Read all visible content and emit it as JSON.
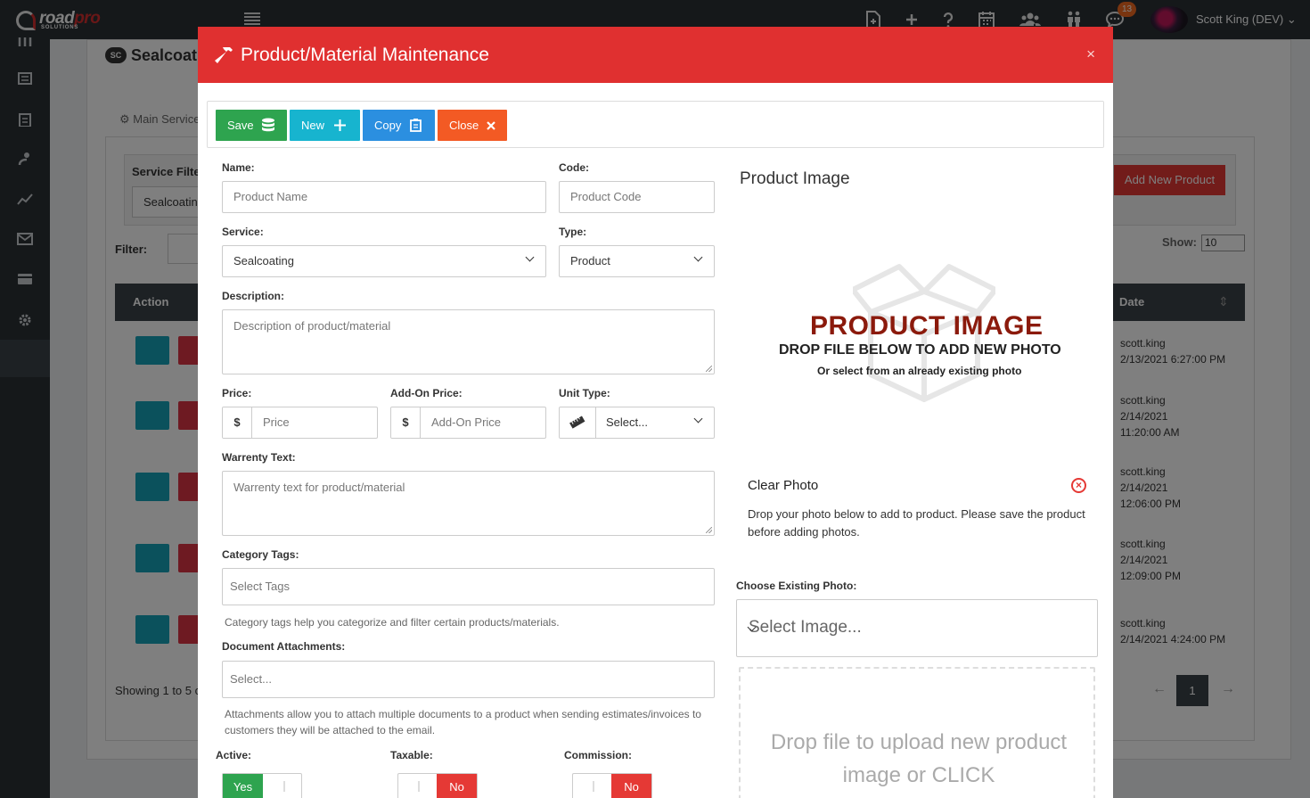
{
  "app": {
    "logo_text_1": "road",
    "logo_text_2": "pro",
    "logo_sub": "SOLUTIONS",
    "notification_count": "13",
    "user_name": "Scott King (DEV)"
  },
  "background": {
    "page_title": "Sealcoati",
    "page_badge": "SC",
    "tab_main_service": "Main Service",
    "service_filter_label": "Service Filte",
    "service_filter_value": "Sealcoatin",
    "filter_label": "Filter:",
    "add_new_product": "Add New Product",
    "show_label": "Show:",
    "show_value": "10",
    "col_action": "Action",
    "col_date": "Date",
    "rows": [
      {
        "user": "scott.king",
        "date": "2/13/2021 6:27:00 PM"
      },
      {
        "user": "scott.king",
        "date": "2/14/2021 11:20:00 AM"
      },
      {
        "user": "scott.king",
        "date": "2/14/2021 12:06:00 PM"
      },
      {
        "user": "scott.king",
        "date": "2/14/2021 12:09:00 PM"
      },
      {
        "user": "scott.king",
        "date": "2/14/2021 4:24:00 PM"
      }
    ],
    "showing": "Showing 1 to 5 o",
    "page_current": "1",
    "prev_arrow": "←",
    "next_arrow": "→"
  },
  "modal": {
    "title": "Product/Material Maintenance",
    "close_symbol": "×",
    "toolbar": {
      "save": "Save",
      "new": "New",
      "copy": "Copy",
      "close": "Close"
    },
    "form": {
      "name_label": "Name:",
      "name_placeholder": "Product Name",
      "code_label": "Code:",
      "code_placeholder": "Product Code",
      "service_label": "Service:",
      "service_value": "Sealcoating",
      "type_label": "Type:",
      "type_value": "Product",
      "description_label": "Description:",
      "description_placeholder": "Description of product/material",
      "price_label": "Price:",
      "price_symbol": "$",
      "price_placeholder": "Price",
      "addon_price_label": "Add-On Price:",
      "addon_price_symbol": "$",
      "addon_price_placeholder": "Add-On Price",
      "unit_type_label": "Unit Type:",
      "unit_type_value": "Select...",
      "warranty_label": "Warrenty Text:",
      "warranty_placeholder": "Warrenty text for product/material",
      "category_tags_label": "Category Tags:",
      "category_tags_placeholder": "Select Tags",
      "category_tags_help": "Category tags help you categorize and filter certain products/materials.",
      "doc_attachments_label": "Document Attachments:",
      "doc_attachments_placeholder": "Select...",
      "doc_attachments_help": "Attachments allow you to attach multiple documents to a product when sending estimates/invoices to customers they will be attached to the email.",
      "active_label": "Active:",
      "active_value": "Yes",
      "taxable_label": "Taxable:",
      "taxable_value": "No",
      "commission_label": "Commission:",
      "commission_value": "No"
    },
    "image": {
      "title": "Product Image",
      "placeholder_big": "PRODUCT IMAGE",
      "placeholder_mid": "DROP FILE BELOW TO ADD NEW PHOTO",
      "placeholder_small": "Or select from an already existing photo",
      "clear_photo": "Clear Photo",
      "clear_desc": "Drop your photo below to add to product. Please save the product before adding photos.",
      "choose_existing_label": "Choose Existing Photo:",
      "select_image_placeholder": "Select Image...",
      "dropzone_text": "Drop file to upload new product image or CLICK"
    }
  },
  "colors": {
    "header_red": "#e03030",
    "save_green": "#2ea44f",
    "new_teal": "#17b4cf",
    "copy_blue": "#2b8fe0",
    "close_orange": "#f35a24"
  }
}
